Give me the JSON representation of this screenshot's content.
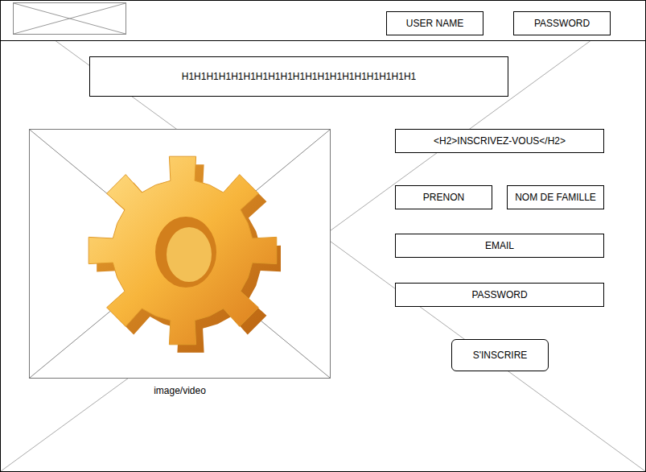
{
  "header": {
    "fields": [
      "USER NAME",
      "PASSWORD"
    ]
  },
  "title": "H1H1H1H1H1H1H1H1H1H1H1H1H1H1H1H1H1H1H1",
  "media": {
    "caption": "image/video"
  },
  "signup": {
    "heading": "<H2>INSCRIVEZ-VOUS</H2>",
    "rows": [
      [
        "PRENON",
        "NOM DE FAMILLE"
      ],
      [
        "EMAIL"
      ],
      [
        "PASSWORD"
      ]
    ],
    "submit": "S'INSCRIRE"
  }
}
